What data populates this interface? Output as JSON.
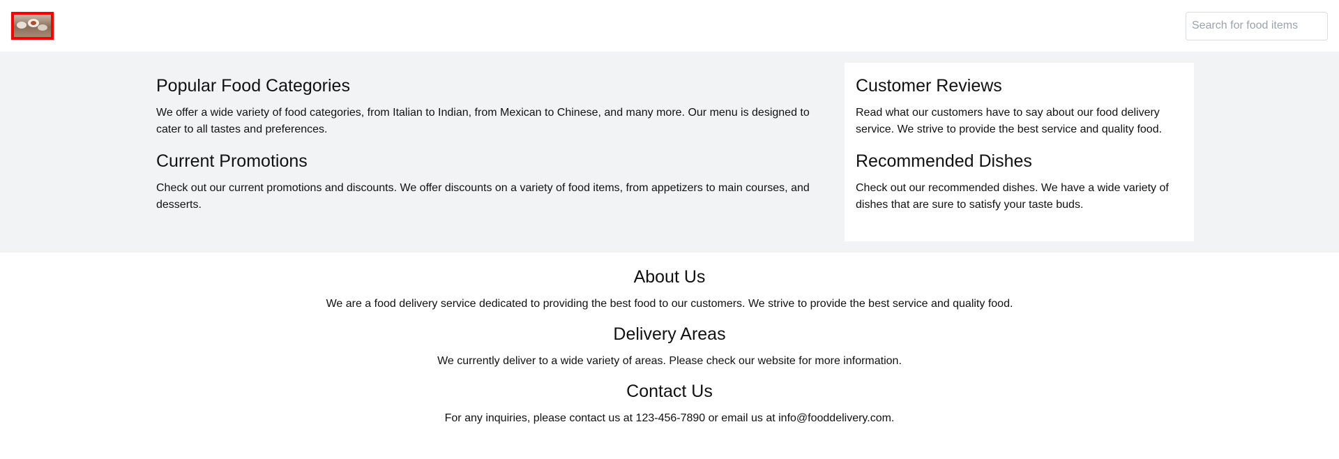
{
  "header": {
    "logo_alt": "Food delivery logo",
    "search_placeholder": "Search for food items"
  },
  "main": {
    "left": [
      {
        "title": "Popular Food Categories",
        "text": "We offer a wide variety of food categories, from Italian to Indian, from Mexican to Chinese, and many more. Our menu is designed to cater to all tastes and preferences."
      },
      {
        "title": "Current Promotions",
        "text": "Check out our current promotions and discounts. We offer discounts on a variety of food items, from appetizers to main courses, and desserts."
      }
    ],
    "right": [
      {
        "title": "Customer Reviews",
        "text": "Read what our customers have to say about our food delivery service. We strive to provide the best service and quality food."
      },
      {
        "title": "Recommended Dishes",
        "text": "Check out our recommended dishes. We have a wide variety of dishes that are sure to satisfy your taste buds."
      }
    ]
  },
  "footer": [
    {
      "title": "About Us",
      "text": "We are a food delivery service dedicated to providing the best food to our customers. We strive to provide the best service and quality food."
    },
    {
      "title": "Delivery Areas",
      "text": "We currently deliver to a wide variety of areas. Please check our website for more information."
    },
    {
      "title": "Contact Us",
      "text": "For any inquiries, please contact us at 123-456-7890 or email us at info@fooddelivery.com."
    }
  ],
  "colors": {
    "logo_border": "#ff0000",
    "band_background": "#f2f3f5",
    "card_background": "#ffffff"
  }
}
